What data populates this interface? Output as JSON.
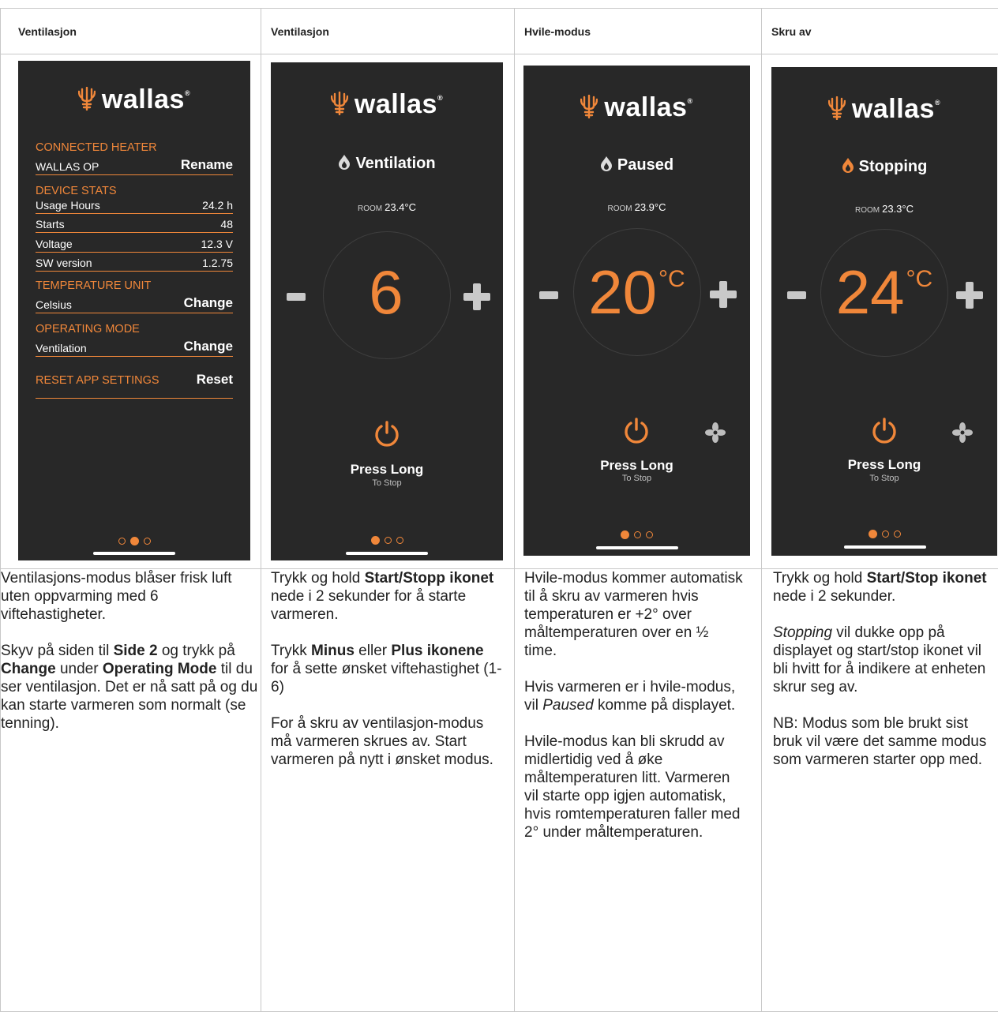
{
  "columns": [
    {
      "header": "Ventilasjon"
    },
    {
      "header": "Ventilasjon"
    },
    {
      "header": "Hvile-modus"
    },
    {
      "header": "Skru av"
    }
  ],
  "brand": {
    "logo_text": "wallas",
    "accent_color": "#f0873a",
    "bg_color": "#282828"
  },
  "settings_screen": {
    "connected_heater_title": "CONNECTED HEATER",
    "heater_name": "WALLAS OP",
    "rename_label": "Rename",
    "device_stats_title": "DEVICE STATS",
    "stats": [
      {
        "label": "Usage Hours",
        "value": "24.2 h"
      },
      {
        "label": "Starts",
        "value": "48"
      },
      {
        "label": "Voltage",
        "value": "12.3 V"
      },
      {
        "label": "SW version",
        "value": "1.2.75"
      }
    ],
    "temperature_unit_title": "TEMPERATURE UNIT",
    "temperature_unit_value": "Celsius",
    "temperature_change_label": "Change",
    "operating_mode_title": "OPERATING MODE",
    "operating_mode_value": "Ventilation",
    "operating_change_label": "Change",
    "reset_title": "RESET APP SETTINGS",
    "reset_label": "Reset"
  },
  "screens": [
    {
      "status": "Ventilation",
      "room_label": "ROOM",
      "room_temp": "23.4°C",
      "value": "6",
      "unit": "",
      "press_label": "Press Long",
      "sub_label": "To Stop"
    },
    {
      "status": "Paused",
      "room_label": "ROOM",
      "room_temp": "23.9°C",
      "value": "20",
      "unit": "°C",
      "press_label": "Press Long",
      "sub_label": "To Stop"
    },
    {
      "status": "Stopping",
      "room_label": "ROOM",
      "room_temp": "23.3°C",
      "value": "24",
      "unit": "°C",
      "press_label": "Press Long",
      "sub_label": "To Stop"
    }
  ],
  "descriptions": {
    "col1": {
      "p1": "Ventilasjons-modus blåser frisk luft uten oppvarming med 6 viftehastigheter.",
      "p2_a": "Skyv på siden til ",
      "p2_b": "Side 2",
      "p2_c": " og trykk på ",
      "p2_d": "Change",
      "p2_e": " under ",
      "p2_f": "Operating Mode",
      "p2_g": " til du ser ventilasjon. Det er nå satt på og du kan starte varmeren som normalt (se tenning)."
    },
    "col2": {
      "p1_a": "Trykk og hold ",
      "p1_b": "Start/Stopp ikonet",
      "p1_c": " nede i 2 sekunder for å starte varmeren.",
      "p2_a": "Trykk ",
      "p2_b": "Minus",
      "p2_c": " eller ",
      "p2_d": "Plus ikonene",
      "p2_e": " for å sette ønsket viftehastighet (1-6)",
      "p3": "For å skru av ventilasjon-modus må varmeren skrues av. Start varmeren på nytt i ønsket modus."
    },
    "col3": {
      "p1": "Hvile-modus kommer automatisk til å skru av varmeren hvis temperaturen er +2° over måltemperaturen over en ½ time.",
      "p2_a": "Hvis varmeren er i hvile-modus, vil ",
      "p2_b": "Paused",
      "p2_c": " komme på displayet.",
      "p3": "Hvile-modus kan bli skrudd av midlertidig ved å øke måltemperaturen litt. Varmeren vil starte opp igjen automatisk, hvis romtemperaturen faller med 2° under måltemperaturen."
    },
    "col4": {
      "p1_a": "Trykk og hold ",
      "p1_b": "Start/Stop ikonet",
      "p1_c": " nede i 2 sekunder.",
      "p2_a": "Stopping",
      "p2_b": " vil dukke opp på displayet og start/stop ikonet vil bli hvitt for å indikere at enheten skrur seg av.",
      "p3": "NB: Modus som ble brukt sist bruk vil være det samme modus som varmeren starter opp med."
    }
  }
}
